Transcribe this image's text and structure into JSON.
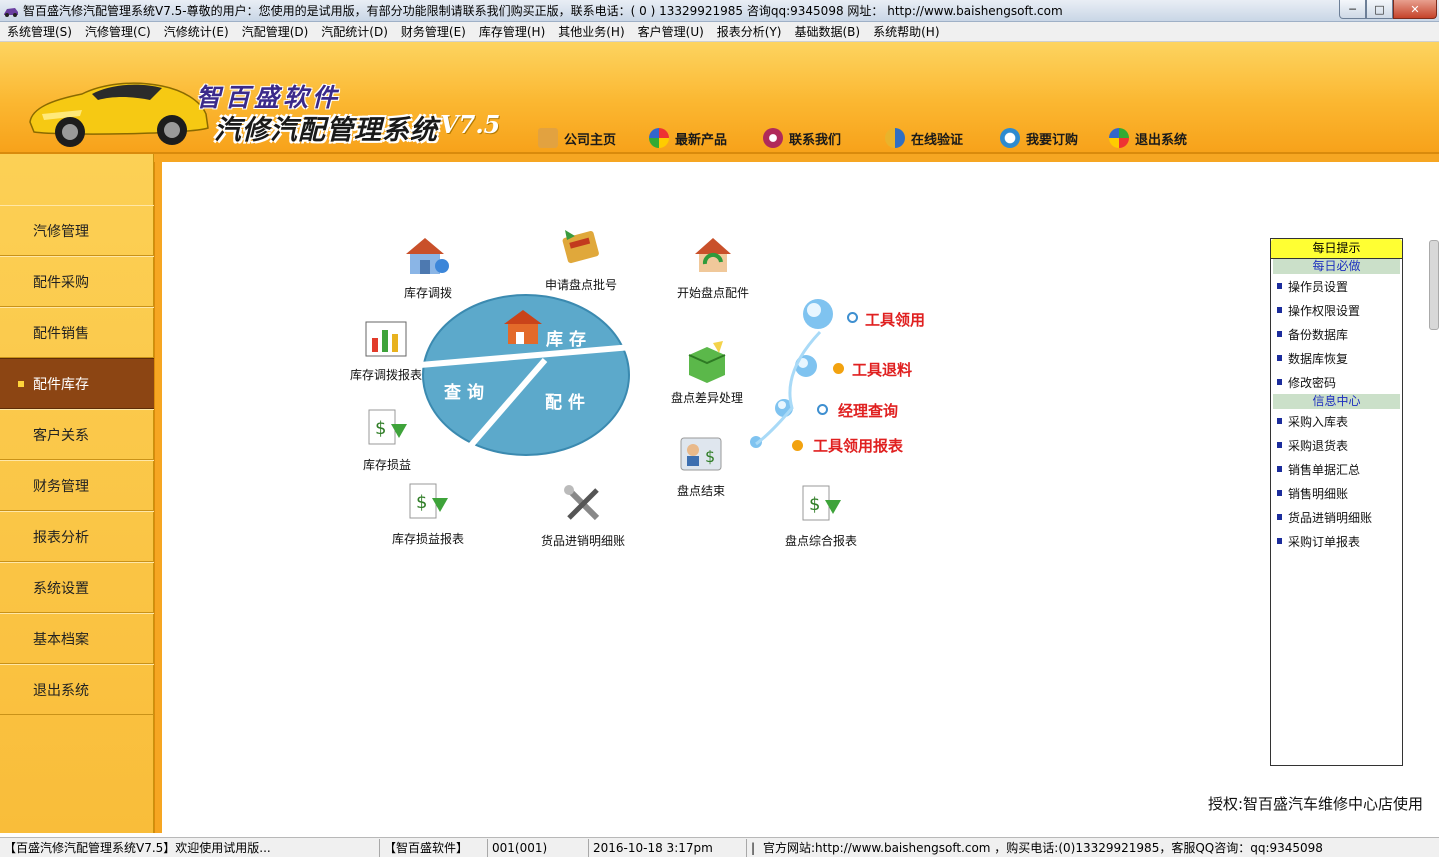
{
  "window": {
    "title": "智百盛汽修汽配管理系统V7.5-尊敬的用户：您使用的是试用版，有部分功能限制请联系我们购买正版，联系电话：( 0 ) 13329921985  咨询qq:9345098   网址： http://www.baishengsoft.com",
    "min_label": "─",
    "max_label": "□",
    "close_label": "✕"
  },
  "menu": [
    "系统管理(S)",
    "汽修管理(C)",
    "汽修统计(E)",
    "汽配管理(D)",
    "汽配统计(D)",
    "财务管理(E)",
    "库存管理(H)",
    "其他业务(H)",
    "客户管理(U)",
    "报表分析(Y)",
    "基础数据(B)",
    "系统帮助(H)"
  ],
  "header": {
    "brand": "智百盛软件",
    "product": "汽修汽配管理系统",
    "version": "V7.5",
    "nav": [
      {
        "label": "公司主页",
        "icon": "home-icon",
        "color": "#d9902a"
      },
      {
        "label": "最新产品",
        "icon": "pinwheel-icon",
        "color": "#3f9b39"
      },
      {
        "label": "联系我们",
        "icon": "contact-icon",
        "color": "#b02a5a"
      },
      {
        "label": "在线验证",
        "icon": "verify-icon",
        "color": "#2f6fc4"
      },
      {
        "label": "我要订购",
        "icon": "order-icon",
        "color": "#2e8bd0"
      },
      {
        "label": "退出系统",
        "icon": "exit-icon",
        "color": "#3f9b39"
      }
    ]
  },
  "sidebar": {
    "items": [
      "汽修管理",
      "配件采购",
      "配件销售",
      "配件库存",
      "客户关系",
      "财务管理",
      "报表分析",
      "系统设置",
      "基本档案",
      "退出系统"
    ],
    "active_index": 3
  },
  "modules": {
    "kucun_diaobo": "库存调拨",
    "shenqing_pandian": "申请盘点批号",
    "kaishi_pandian": "开始盘点配件",
    "diaobo_baobiao": "库存调拨报表",
    "pandian_chayi": "盘点差异处理",
    "kucun_sunyi": "库存损益",
    "pandian_jieshu": "盘点结束",
    "sunyi_baobiao": "库存损益报表",
    "huopin_mingxi": "货品进销明细账",
    "pandian_zonghe": "盘点综合报表"
  },
  "disk": {
    "top": "库存",
    "left": "查询",
    "right": "配件"
  },
  "tools": [
    "工具领用",
    "工具退料",
    "经理查询",
    "工具领用报表"
  ],
  "tips": {
    "header": "每日提示",
    "section1": "每日必做",
    "items1": [
      "操作员设置",
      "操作权限设置",
      "备份数据库",
      "数据库恢复",
      "修改密码"
    ],
    "section2": "信息中心",
    "items2": [
      "采购入库表",
      "采购退货表",
      "销售单据汇总",
      "销售明细账",
      "货品进销明细账",
      "采购订单报表"
    ]
  },
  "license": "授权:智百盛汽车维修中心店使用",
  "status": {
    "welcome": "【百盛汽修汽配管理系统V7.5】欢迎使用试用版...",
    "company": "【智百盛软件】",
    "user": "001(001)",
    "datetime": "2016-10-18 3:17pm",
    "sep": "|",
    "contact": "官方网站:http://www.baishengsoft.com ，购买电话:(0)13329921985，客服QQ咨询：qq:9345098"
  }
}
